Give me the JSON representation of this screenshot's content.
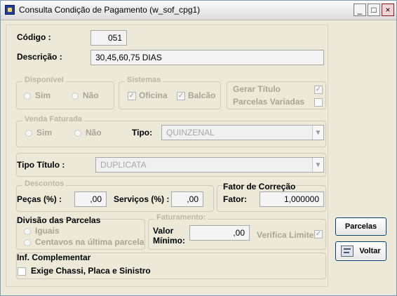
{
  "window": {
    "title": "Consulta Condição de Pagamento (w_sof_cpg1)",
    "controls": {
      "minimize": "_",
      "maximize": "□",
      "close": "×"
    }
  },
  "basic": {
    "codigo_label": "Código :",
    "codigo_value": "051",
    "descricao_label": "Descrição :",
    "descricao_value": "30,45,60,75 DIAS"
  },
  "disponivel": {
    "title": "Disponível",
    "sim": "Sim",
    "nao": "Não"
  },
  "sistemas": {
    "title": "Sistemas",
    "oficina": "Oficina",
    "balcao": "Balcão"
  },
  "options": {
    "gerar_titulo": "Gerar Título",
    "parcelas_variadas": "Parcelas Variadas"
  },
  "venda_faturada": {
    "title": "Venda Faturada",
    "sim": "Sim",
    "nao": "Não",
    "tipo_label": "Tipo:",
    "tipo_value": "QUINZENAL"
  },
  "tipo_titulo": {
    "label": "Tipo Título :",
    "value": "DUPLICATA"
  },
  "descontos": {
    "title": "Descontos",
    "pecas_label": "Peças (%) :",
    "pecas_value": ",00",
    "servicos_label": "Serviços (%) :",
    "servicos_value": ",00"
  },
  "fator": {
    "title": "Fator de Correção",
    "label": "Fator:",
    "value": "1,000000"
  },
  "divisao": {
    "title": "Divisão das Parcelas",
    "iguais": "Iguais",
    "centavos": "Centavos na última parcela"
  },
  "faturamento": {
    "title": "Faturamento:",
    "valor_label_1": "Valor",
    "valor_label_2": "Mínimo:",
    "valor_value": ",00",
    "verifica_limite": "Verifica Limite"
  },
  "inf_complementar": {
    "title": "Inf. Complementar",
    "exige": "Exige Chassi, Placa e Sinistro"
  },
  "buttons": {
    "parcelas": "Parcelas",
    "voltar": "Voltar"
  },
  "icons": {
    "app": "app-icon",
    "min": "minimize-icon",
    "max": "maximize-icon",
    "close": "close-icon",
    "voltar": "back-icon"
  }
}
